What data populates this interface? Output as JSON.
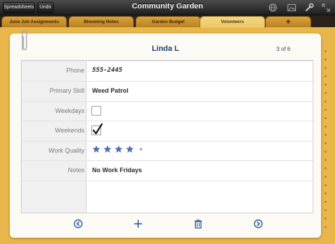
{
  "toolbar": {
    "spreadsheets_label": "Spreadsheets",
    "undo_label": "Undo",
    "title": "Community Garden",
    "icons": [
      "globe-icon",
      "photo-icon",
      "wrench-icon",
      "expand-icon"
    ]
  },
  "tabs": [
    {
      "label": "June Job Assignments",
      "active": false
    },
    {
      "label": "Blooming Notes",
      "active": false
    },
    {
      "label": "Garden Budget",
      "active": false
    },
    {
      "label": "Volunteers",
      "active": true
    },
    {
      "label": "+",
      "active": false
    }
  ],
  "record": {
    "title": "Linda L",
    "counter": "3 of 6"
  },
  "fields": {
    "phone": {
      "label": "Phone",
      "value": "555-2445"
    },
    "primary_skill": {
      "label": "Primary Skill",
      "value": "Weed Patrol"
    },
    "weekdays": {
      "label": "Weekdays",
      "checked": false
    },
    "weekends": {
      "label": "Weekends",
      "checked": true
    },
    "work_quality": {
      "label": "Work Quality",
      "rating": 4,
      "max": 5
    },
    "notes": {
      "label": "Notes",
      "value": "No Work Fridays"
    }
  },
  "bottom_bar": {
    "icons": [
      "previous-record-icon",
      "add-record-icon",
      "delete-record-icon",
      "next-record-icon"
    ]
  },
  "colors": {
    "background": "#e8b64a",
    "title_blue": "#203a76",
    "icon_blue": "#2f57a8",
    "star_color": "#4f6fa8"
  }
}
